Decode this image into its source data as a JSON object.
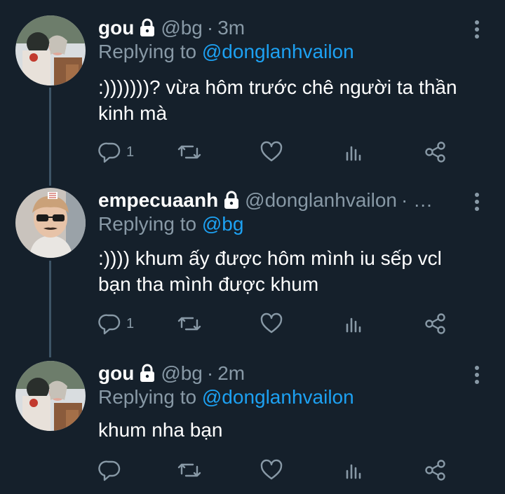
{
  "tweets": [
    {
      "name": "gou",
      "handle": "@bg",
      "time": "3m",
      "replying_prefix": "Replying to ",
      "replying_to": "@donglanhvailon",
      "text_lines": [
        ":)))))))? vừa hôm trước chê người ta thần",
        "kinh mà"
      ],
      "reply_count": "1",
      "avatar": "avatar-illustration"
    },
    {
      "name": "empecuaanh",
      "handle": "@donglanhvailon",
      "time": "· …",
      "replying_prefix": "Replying to ",
      "replying_to": "@bg",
      "text_lines": [
        ":)))) khum ấy được hôm mình iu sếp vcl",
        "bạn tha mình được khum"
      ],
      "reply_count": "1",
      "avatar": "avatar-photo"
    },
    {
      "name": "gou",
      "handle": "@bg",
      "time": "2m",
      "replying_prefix": "Replying to ",
      "replying_to": "@donglanhvailon",
      "text_lines": [
        "khum nha bạn"
      ],
      "reply_count": "",
      "avatar": "avatar-illustration"
    }
  ],
  "icons": {
    "lock": "lock-icon",
    "more": "more-vertical-icon",
    "reply": "reply-icon",
    "retweet": "retweet-icon",
    "like": "heart-icon",
    "stats": "stats-icon",
    "share": "share-icon"
  },
  "colors": {
    "background": "#15202b",
    "text": "#ffffff",
    "muted": "#8899a6",
    "mention": "#1da1f2",
    "thread_line": "#3d5466"
  }
}
